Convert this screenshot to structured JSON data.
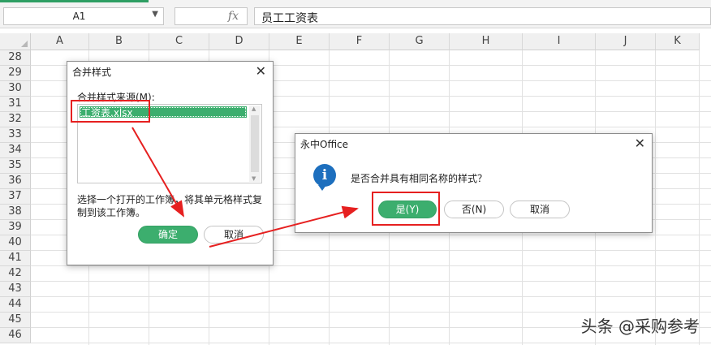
{
  "formula_bar": {
    "name_box": "A1",
    "fx_label": "fx",
    "content": "员工工资表"
  },
  "columns": [
    "A",
    "B",
    "C",
    "D",
    "E",
    "F",
    "G",
    "H",
    "I",
    "J",
    "K"
  ],
  "rows": [
    "28",
    "29",
    "30",
    "31",
    "32",
    "33",
    "34",
    "35",
    "36",
    "37",
    "38",
    "39",
    "40",
    "41",
    "42",
    "43",
    "44",
    "45",
    "46"
  ],
  "merge_dialog": {
    "title": "合并样式",
    "source_label": "合并样式来源(M):",
    "source_items": [
      "工资表.xlsx"
    ],
    "hint": "选择一个打开的工作簿，将其单元格样式复制到该工作簿。",
    "hint_line1": "选择一个打开的工作簿，将其单元格样式复",
    "hint_line2": "制到该工作簿。",
    "ok_label": "确定",
    "cancel_label": "取消"
  },
  "confirm_dialog": {
    "title": "永中Office",
    "message": "是否合并具有相同名称的样式？",
    "yes_label": "是(Y)",
    "no_label": "否(N)",
    "cancel_label": "取消"
  },
  "watermark": "头条 @采购参考",
  "colors": {
    "accent_green": "#3cae6e",
    "annotation_red": "#e62020",
    "info_blue": "#1d6fbe"
  }
}
